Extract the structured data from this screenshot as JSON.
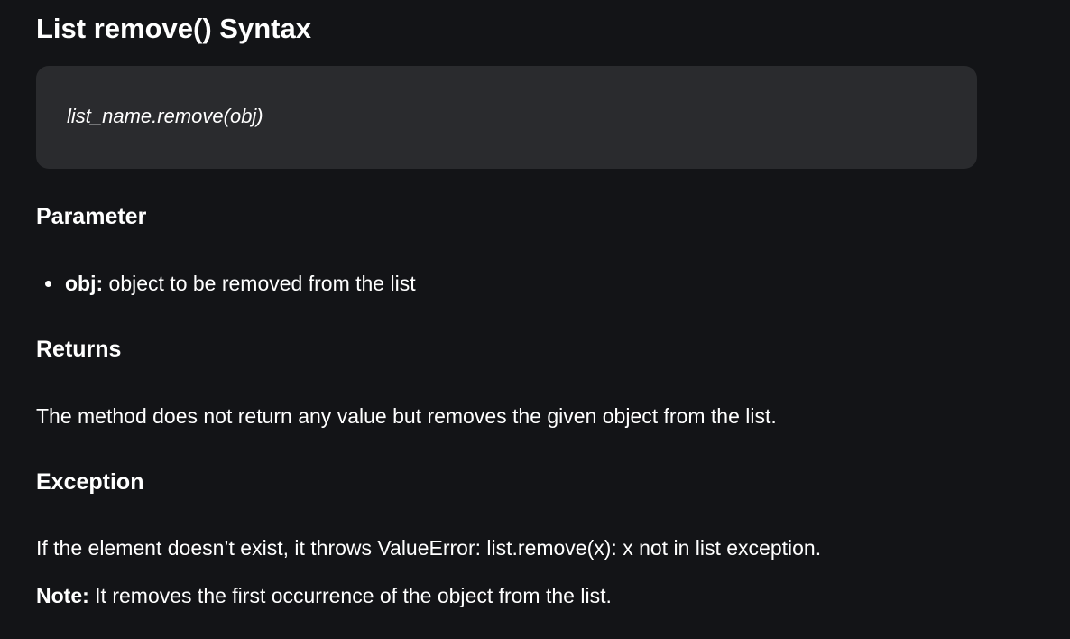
{
  "title": "List remove() Syntax",
  "code": "list_name.remove(obj)",
  "sections": {
    "parameter": {
      "heading": "Parameter",
      "items": [
        {
          "term": "obj:",
          "description": "object to be removed from the list"
        }
      ]
    },
    "returns": {
      "heading": "Returns",
      "text": "The method does not return any value but removes the given object from the list."
    },
    "exception": {
      "heading": "Exception",
      "text": "If the element doesn’t exist, it throws ValueError: list.remove(x): x not in list exception."
    },
    "note": {
      "label": "Note:",
      "text": "It removes the first occurrence of the object from the list."
    }
  },
  "colors": {
    "background": "#131417",
    "code_background": "#2a2b2e",
    "text": "#ffffff"
  }
}
